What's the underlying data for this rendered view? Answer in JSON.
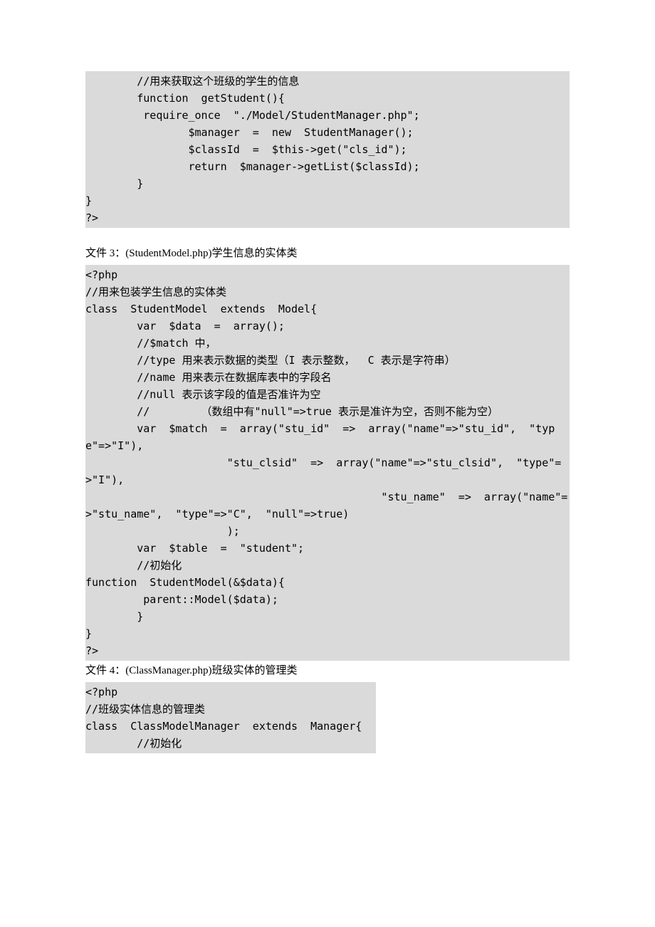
{
  "block1": {
    "l1": "        //用来获取这个班级的学生的信息",
    "l2": "        function  getStudent(){",
    "l3": "         require_once  \"./Model/StudentManager.php\";",
    "l4": "                $manager  =  new  StudentManager();",
    "l5": "                $classId  =  $this->get(\"cls_id\");",
    "l6": "                return  $manager->getList($classId);",
    "l7": "        }",
    "l8": "}",
    "l9": "?>"
  },
  "caption2": "文件 3：(StudentModel.php)学生信息的实体类",
  "block2": {
    "l1": "<?php",
    "l2": "//用来包装学生信息的实体类",
    "l3": "class  StudentModel  extends  Model{",
    "l4": "",
    "l5": "        var  $data  =  array();",
    "l6": "        //$match 中，",
    "l7": "        //type 用来表示数据的类型（I 表示整数，  C 表示是字符串）",
    "l8": "        //name 用来表示在数据库表中的字段名",
    "l9": "        //null 表示该字段的值是否准许为空",
    "l10": "        //        （数组中有\"null\"=>true 表示是准许为空，否则不能为空）",
    "l11": "        var  $match  =  array(\"stu_id\"  =>  array(\"name\"=>\"stu_id\",  \"type\"=>\"I\"),",
    "l12": "                      \"stu_clsid\"  =>  array(\"name\"=>\"stu_clsid\",  \"type\"=>\"I\"),",
    "l13": "                                              \"stu_name\"  =>  array(\"name\"=>\"stu_name\",  \"type\"=>\"C\",  \"null\"=>true)",
    "l14": "                      );",
    "l15": "",
    "l16": "        var  $table  =  \"student\";",
    "l17": "        //初始化",
    "l18": "function  StudentModel(&$data){",
    "l19": "         parent::Model($data);",
    "l20": "        }",
    "l21": "}",
    "l22": "?>"
  },
  "caption3": "文件 4：(ClassManager.php)班级实体的管理类",
  "block3": {
    "l1": "<?php",
    "l2": "//班级实体信息的管理类",
    "l3": "class  ClassModelManager  extends  Manager{",
    "l4": "        //初始化"
  }
}
